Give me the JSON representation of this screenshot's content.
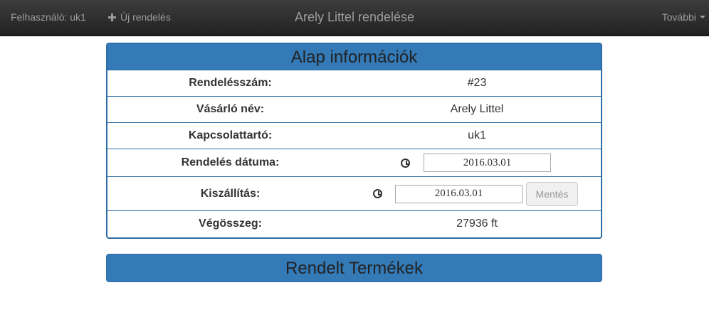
{
  "navbar": {
    "user_label": "Felhasználó: uk1",
    "new_order_label": "Új rendelés",
    "title": "Arely Littel rendelése",
    "more_label": "További"
  },
  "info_panel": {
    "title": "Alap információk",
    "rows": {
      "order_number": {
        "label": "Rendelésszám:",
        "value": "#23"
      },
      "customer": {
        "label": "Vásárló név:",
        "value": "Arely Littel"
      },
      "contact": {
        "label": "Kapcsolattartó:",
        "value": "uk1"
      },
      "order_date": {
        "label": "Rendelés dátuma:",
        "value": "2016.03.01"
      },
      "delivery": {
        "label": "Kiszállítás:",
        "value": "2016.03.01",
        "button": "Mentés"
      },
      "total": {
        "label": "Végösszeg:",
        "value": "27936 ft"
      }
    }
  },
  "products_panel": {
    "title": "Rendelt Termékek"
  },
  "colors": {
    "navbar": "#222222",
    "panel_primary": "#337ab7",
    "panel_border": "#2e6da4"
  }
}
